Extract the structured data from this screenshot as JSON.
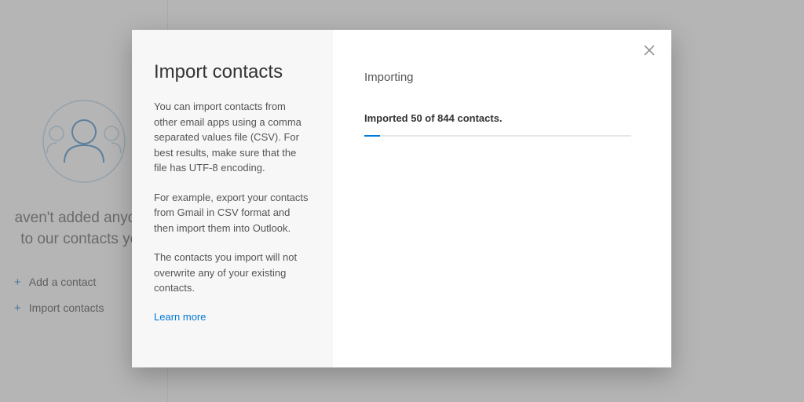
{
  "background": {
    "empty_heading": "aven't added anyone to our contacts yet.",
    "add_contact_label": "Add a contact",
    "import_contacts_label": "Import contacts"
  },
  "dialog": {
    "title": "Import contacts",
    "para1": "You can import contacts from other email apps using a comma separated values file (CSV). For best results, make sure that the file has UTF-8 encoding.",
    "para2": "For example, export your contacts from Gmail in CSV format and then import them into Outlook.",
    "para3": "The contacts you import will not overwrite any of your existing contacts.",
    "learn_more": "Learn more",
    "status_title": "Importing",
    "status_text": "Imported 50 of 844 contacts.",
    "progress_percent": 6
  }
}
